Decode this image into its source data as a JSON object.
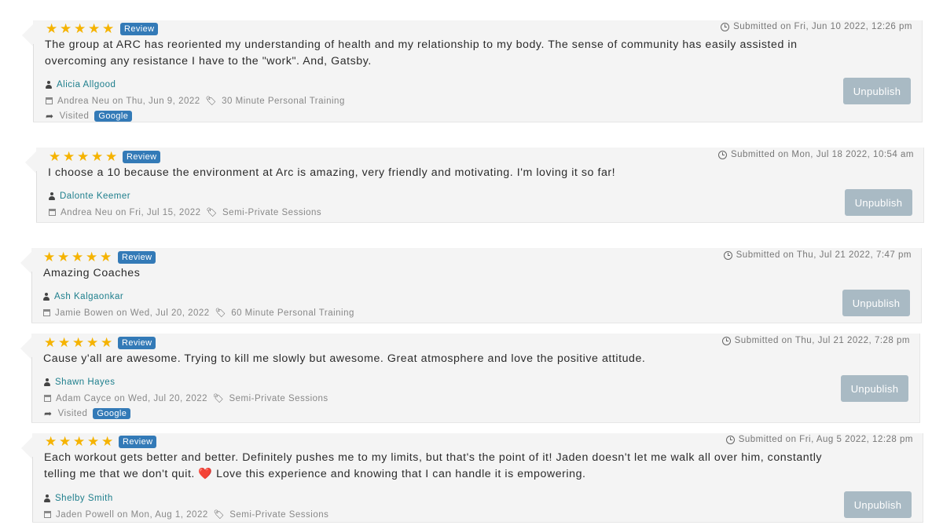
{
  "colors": {
    "star": "#f5b301",
    "badge": "#337ab7",
    "author": "#1d7e8c",
    "button": "#a9bac4",
    "card": "#f4f4f4"
  },
  "reviews": [
    {
      "rating": 5,
      "badge": "Review",
      "submitted": "Submitted on Fri, Jun 10 2022, 12:26 pm",
      "text": "The group at ARC has reoriented my understanding of health and my relationship to my body. The sense of community has easily assisted in\novercoming any resistance I have to the \"work\". And, Gatsby.",
      "author": "Alicia Allgood",
      "session_meta": "Andrea Neu on Thu, Jun 9, 2022",
      "session_type": "30 Minute Personal Training",
      "visited_label": "Visited",
      "visited_source": "Google",
      "button": "Unpublish"
    },
    {
      "rating": 5,
      "badge": "Review",
      "submitted": "Submitted on Mon, Jul 18 2022, 10:54 am",
      "text": "I choose a 10 because the environment at Arc is amazing, very friendly and motivating. I'm loving it so far!",
      "author": "Dalonte Keemer",
      "session_meta": "Andrea Neu on Fri, Jul 15, 2022",
      "session_type": "Semi-Private Sessions",
      "button": "Unpublish"
    },
    {
      "rating": 5,
      "badge": "Review",
      "submitted": "Submitted on Thu, Jul 21 2022, 7:47 pm",
      "text": "Amazing Coaches",
      "author": "Ash Kalgaonkar",
      "session_meta": "Jamie Bowen on Wed, Jul 20, 2022",
      "session_type": "60 Minute Personal Training",
      "button": "Unpublish"
    },
    {
      "rating": 5,
      "badge": "Review",
      "submitted": "Submitted on Thu, Jul 21 2022, 7:28 pm",
      "text": "Cause y'all are awesome. Trying to kill me slowly but awesome. Great atmosphere and love the positive attitude.",
      "author": "Shawn Hayes",
      "session_meta": "Adam Cayce on Wed, Jul 20, 2022",
      "session_type": "Semi-Private Sessions",
      "visited_label": "Visited",
      "visited_source": "Google",
      "button": "Unpublish"
    },
    {
      "rating": 5,
      "badge": "Review",
      "submitted": "Submitted on Fri, Aug 5 2022, 12:28 pm",
      "text": "Each workout gets better and better. Definitely pushes me to my limits, but that's the point of it! Jaden doesn't let me walk all over him, constantly\ntelling me that we don't quit. ❤️ Love this experience and knowing that I can handle it is empowering.",
      "author": "Shelby Smith",
      "session_meta": "Jaden Powell on Mon, Aug 1, 2022",
      "session_type": "Semi-Private Sessions",
      "button": "Unpublish"
    }
  ]
}
